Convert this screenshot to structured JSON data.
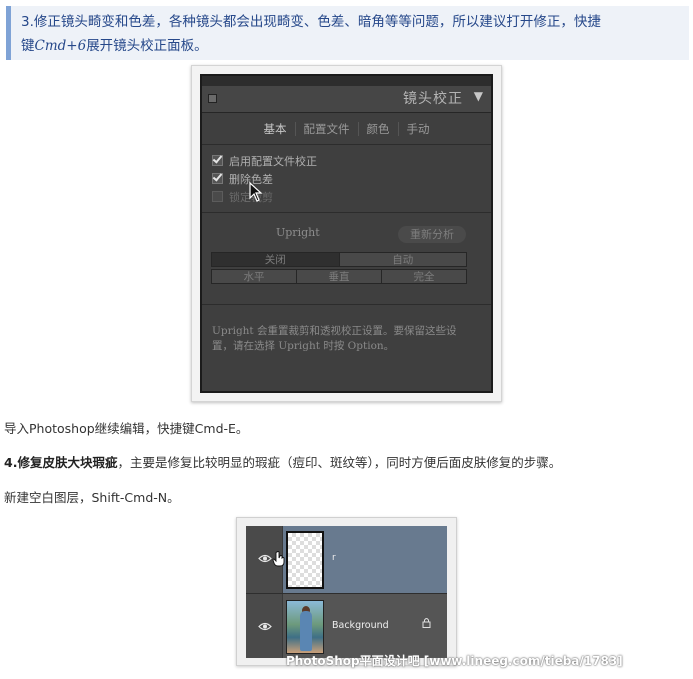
{
  "step3": {
    "title": "3.修正镜头畸变和色差，各种镜头都会出现畸变、色差、暗角等等问题，所以建议打开修正，快捷",
    "line2_prefix": "键",
    "shortcut": "Cmd+6",
    "line2_suffix": "展开镜头校正面板。"
  },
  "lens_panel": {
    "title": "镜头校正",
    "collapse_glyph": "▼",
    "tabs": [
      "基本",
      "配置文件",
      "颜色",
      "手动"
    ],
    "checkboxes": [
      {
        "label": "启用配置文件校正",
        "checked": true
      },
      {
        "label": "删除色差",
        "checked": true
      },
      {
        "label": "锁定裁剪",
        "checked": false
      }
    ],
    "upright_label": "Upright",
    "reanalyze": "重新分析",
    "row1": [
      "关闭",
      "自动"
    ],
    "row2": [
      "水平",
      "垂直",
      "完全"
    ],
    "note": "Upright 会重置裁剪和透视校正设置。要保留这些设置，请在选择 Upright 时按 Option。"
  },
  "para1": "导入Photoshop继续编辑，快捷键Cmd-E。",
  "step4": {
    "bold": "4.修复皮肤大块瑕疵",
    "rest": "，主要是修复比较明显的瑕疵（痘印、斑纹等），同时方便后面皮肤修复的步骤。"
  },
  "para2": "新建空白图层，Shift-Cmd-N。",
  "layers_panel": {
    "layer1_name": "r",
    "layer2_name": "Background"
  },
  "watermark": "PhotoShop平面设计吧 [www.lineeg.com/tieba/1783]"
}
